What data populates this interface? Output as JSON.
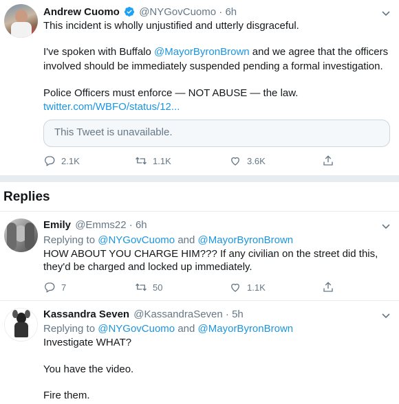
{
  "main_tweet": {
    "name": "Andrew Cuomo",
    "handle": "@NYGovCuomo",
    "time": "· 6h",
    "line1": "This incident is wholly unjustified and utterly disgraceful.",
    "line2_pre": "I've spoken with Buffalo ",
    "line2_mention": "@MayorByronBrown",
    "line2_post": " and we agree that the officers",
    "line3": "involved should be immediately suspended pending a formal investigation.",
    "line4": "Police Officers must enforce — NOT ABUSE — the law.",
    "link": "twitter.com/WBFO/status/12...",
    "quoted": "This Tweet is unavailable.",
    "replies": "2.1K",
    "retweets": "1.1K",
    "likes": "3.6K"
  },
  "replies_header": "Replies",
  "reply1": {
    "name": "Emily",
    "handle": "@Emms22",
    "time": "· 6h",
    "replying_label": "Replying to ",
    "replying_to1": "@NYGovCuomo",
    "replying_and": " and ",
    "replying_to2": "@MayorByronBrown",
    "line1": "HOW ABOUT YOU CHARGE HIM??? If any civilian on the street did this,",
    "line2": "they'd be charged and locked up immediately.",
    "replies": "7",
    "retweets": "50",
    "likes": "1.1K"
  },
  "reply2": {
    "name": "Kassandra Seven",
    "handle": "@KassandraSeven",
    "time": "· 5h",
    "replying_label": "Replying to ",
    "replying_to1": "@NYGovCuomo",
    "replying_and": " and ",
    "replying_to2": "@MayorByronBrown",
    "line1": "Investigate WHAT?",
    "line2": "You have the video.",
    "line3": "Fire them."
  },
  "colors": {
    "link": "#1b95e0",
    "muted": "#657786",
    "verified": "#1da1f2",
    "divider": "#e6ecf0"
  },
  "icons": [
    "verified-badge-icon",
    "chevron-down-icon",
    "reply-icon",
    "retweet-icon",
    "like-icon",
    "share-icon"
  ]
}
